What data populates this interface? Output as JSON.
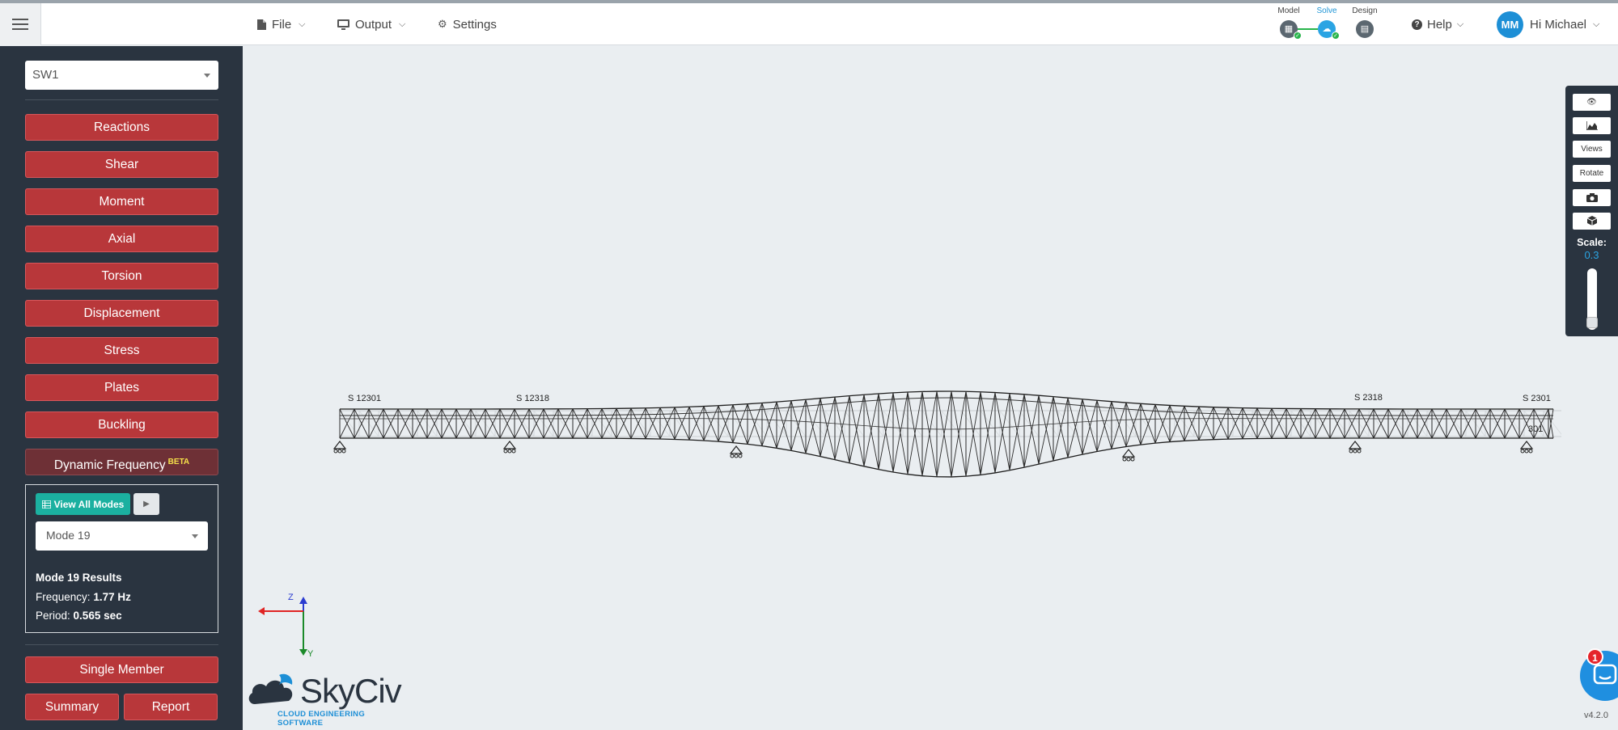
{
  "topbar": {
    "menu": [
      {
        "label": "File",
        "icon": "file-icon"
      },
      {
        "label": "Output",
        "icon": "monitor-icon"
      },
      {
        "label": "Settings",
        "icon": "gear-icon"
      }
    ],
    "steps": [
      {
        "label": "Model",
        "status": "complete"
      },
      {
        "label": "Solve",
        "status": "active"
      },
      {
        "label": "Design",
        "status": "pending"
      }
    ],
    "help_label": "Help",
    "user": {
      "initials": "MM",
      "greeting": "Hi Michael"
    }
  },
  "sidebar": {
    "load_case": "SW1",
    "result_buttons": [
      "Reactions",
      "Shear",
      "Moment",
      "Axial",
      "Torsion",
      "Displacement",
      "Stress",
      "Plates",
      "Buckling"
    ],
    "dynamic_frequency": {
      "label": "Dynamic Frequency",
      "badge": "BETA"
    },
    "modes_panel": {
      "view_all_label": "View All Modes",
      "selected_mode": "Mode 19",
      "results_title": "Mode 19 Results",
      "frequency_label": "Frequency:",
      "frequency_value": "1.77 Hz",
      "period_label": "Period:",
      "period_value": "0.565 sec"
    },
    "single_member_label": "Single Member",
    "summary_label": "Summary",
    "report_label": "Report"
  },
  "viewport": {
    "node_labels": [
      "S 12301",
      "S 12318",
      "S 2318",
      "S 2301",
      "301"
    ],
    "axes": {
      "z": "Z",
      "y": "Y"
    }
  },
  "right_toolbar": {
    "buttons": [
      {
        "name": "eye-icon"
      },
      {
        "name": "chart-area-icon"
      },
      {
        "label": "Views"
      },
      {
        "label": "Rotate"
      },
      {
        "name": "camera-icon"
      },
      {
        "name": "cube-icon"
      }
    ],
    "scale_label": "Scale:",
    "scale_value": "0.3"
  },
  "brand": {
    "name": "SkyCiv",
    "tagline": "CLOUD ENGINEERING SOFTWARE"
  },
  "chat_badge": "1",
  "version": "v4.2.0",
  "colors": {
    "sidebar": "#2a3440",
    "result_button": "#b8373a",
    "accent": "#2aa4e3",
    "view_all": "#1bb0a0"
  }
}
